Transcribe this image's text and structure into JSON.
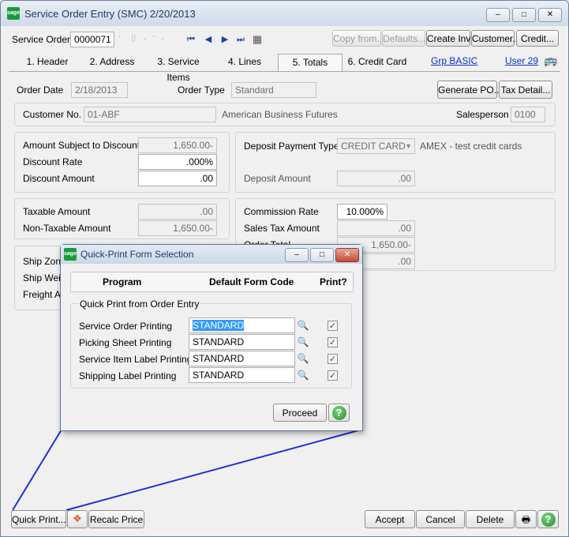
{
  "window": {
    "title": "Service Order Entry (SMC) 2/20/2013",
    "logo": "sage",
    "controls": {
      "minimize": "‒",
      "maximize": "□",
      "close": "✕"
    }
  },
  "toolbar": {
    "service_order_label": "Service Order",
    "service_order_value": "0000071",
    "copy_from": "Copy from...",
    "defaults": "Defaults...",
    "create_inv": "Create Inv",
    "customer": "Customer...",
    "credit": "Credit..."
  },
  "tabs": [
    {
      "label": "1. Header"
    },
    {
      "label": "2. Address"
    },
    {
      "label": "3. Service Items"
    },
    {
      "label": "4. Lines"
    },
    {
      "label": "5. Totals",
      "active": true
    },
    {
      "label": "6. Credit Card"
    }
  ],
  "links": {
    "grp": "Grp BASIC",
    "user": "User 29"
  },
  "header": {
    "order_date_label": "Order Date",
    "order_date": "2/18/2013",
    "order_type_label": "Order Type",
    "order_type": "Standard",
    "generate_po": "Generate PO...",
    "tax_detail": "Tax Detail..."
  },
  "customer": {
    "label": "Customer No.",
    "number": "01-ABF",
    "name": "American Business Futures",
    "salesperson_label": "Salesperson",
    "salesperson": "0100"
  },
  "discount": {
    "amount_subject_label": "Amount Subject to Discount",
    "amount_subject": "1,650.00-",
    "rate_label": "Discount Rate",
    "rate": ".000%",
    "amount_label": "Discount Amount",
    "amount": ".00"
  },
  "deposit": {
    "payment_type_label": "Deposit Payment Type",
    "payment_type": "CREDIT CARD",
    "payment_desc": "AMEX  - test credit cards",
    "amount_label": "Deposit Amount",
    "amount": ".00"
  },
  "tax": {
    "taxable_label": "Taxable Amount",
    "taxable": ".00",
    "nontaxable_label": "Non-Taxable Amount",
    "nontaxable": "1,650.00-"
  },
  "commission": {
    "rate_label": "Commission Rate",
    "rate": "10.000%",
    "sales_tax_label": "Sales Tax Amount",
    "sales_tax": ".00",
    "order_total_label": "Order Total",
    "order_total": "1,650.00-",
    "extra_value": ".00"
  },
  "shipping": {
    "ship_zone_label": "Ship Zone",
    "ship_weight_label": "Ship Weig",
    "freight_label": "Freight Am"
  },
  "bottom": {
    "quick_print": "Quick Print...",
    "recalc_price": "Recalc Price",
    "accept": "Accept",
    "cancel": "Cancel",
    "delete": "Delete"
  },
  "dialog": {
    "title": "Quick-Print Form Selection",
    "col_program": "Program",
    "col_form_code": "Default Form Code",
    "col_print": "Print?",
    "group_label": "Quick Print from Order Entry",
    "rows": [
      {
        "program": "Service Order Printing",
        "form_code": "STANDARD",
        "print": true
      },
      {
        "program": "Picking Sheet Printing",
        "form_code": "STANDARD",
        "print": true
      },
      {
        "program": "Service Item Label Printing",
        "form_code": "STANDARD",
        "print": true
      },
      {
        "program": "Shipping Label Printing",
        "form_code": "STANDARD",
        "print": true
      }
    ],
    "proceed": "Proceed",
    "help": "?"
  },
  "colors": {
    "accent_line": "#1b2fd6",
    "link": "#0033cc",
    "sage_green": "#1a9a3a"
  }
}
